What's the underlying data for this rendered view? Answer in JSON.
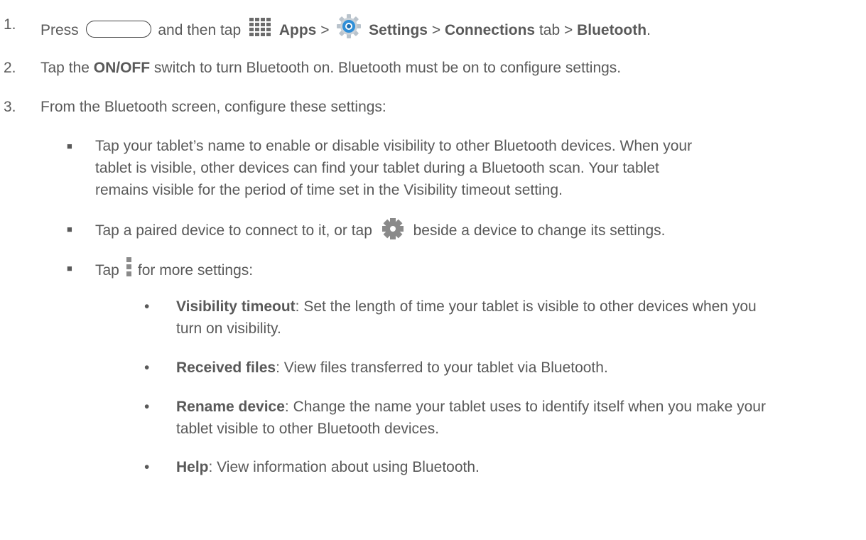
{
  "steps": {
    "s1": {
      "num": "1.",
      "press": "Press",
      "and_then_tap": "and then tap",
      "apps": "Apps",
      "sep1": ">",
      "settings": "Settings",
      "sep2": ">",
      "connections": "Connections",
      "tab_sep": "tab >",
      "bluetooth": "Bluetooth",
      "period": "."
    },
    "s2": {
      "num": "2.",
      "tap": "Tap the",
      "onoff": "ON/OFF",
      "rest": "switch to turn Bluetooth on. Bluetooth must be on to configure settings."
    },
    "s3": {
      "num": "3.",
      "text": "From the Bluetooth screen, configure these settings:"
    }
  },
  "bullets": {
    "b1": {
      "line1": "Tap your tablet’s name to enable or disable visibility to other Bluetooth devices. When your",
      "line2": "tablet is visible, other devices can find your tablet during a Bluetooth scan. Your tablet",
      "line3": "remains visible for the period of time set in the Visibility timeout setting."
    },
    "b2": {
      "before": "Tap a paired device to connect to it, or tap",
      "after": "beside a device to change its settings."
    },
    "b3": {
      "before": "Tap",
      "after": "for more settings:"
    }
  },
  "sub": {
    "visibility": {
      "label": "Visibility timeout",
      "line1": ": Set the length of time your tablet is visible to other devices when you",
      "line2": "turn on visibility."
    },
    "received": {
      "label": "Received files",
      "line1": ": View files transferred to your tablet via Bluetooth."
    },
    "rename": {
      "label": "Rename device",
      "line1": ": Change the name your tablet uses to identify itself when you make your",
      "line2": "tablet visible to other Bluetooth devices."
    },
    "help": {
      "label": "Help",
      "line1": ": View information about using Bluetooth."
    }
  },
  "glyphs": {
    "square_bullet": "■",
    "dot_bullet": "•"
  },
  "icons": [
    "home-button-icon",
    "apps-grid-icon",
    "settings-icon",
    "gear-icon",
    "menu-more-icon"
  ],
  "colors": {
    "text": "#595959",
    "settings_blue": "#2f8fd8",
    "gear_gray": "#8a8a8a"
  }
}
